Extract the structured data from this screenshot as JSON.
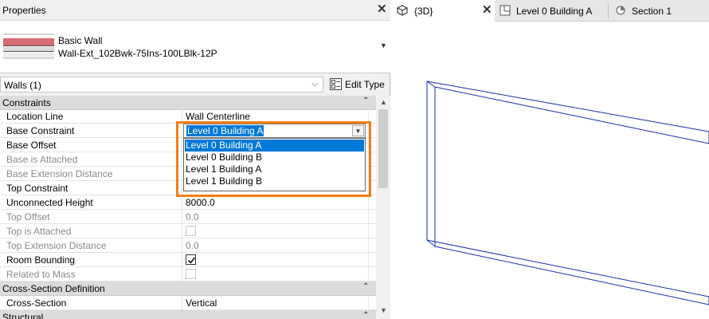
{
  "properties": {
    "title": "Properties",
    "type_family": "Basic Wall",
    "type_name": "Wall-Ext_102Bwk-75Ins-100LBlk-12P",
    "instance_filter": "Walls (1)",
    "edit_type_label": "Edit Type"
  },
  "groups": {
    "constraints": "Constraints",
    "cross_section": "Cross-Section Definition",
    "next_partial": "Structural"
  },
  "params": {
    "location_line": {
      "name": "Location Line",
      "value": "Wall Centerline"
    },
    "base_constraint": {
      "name": "Base Constraint",
      "value": "Level 0 Building A"
    },
    "base_offset": {
      "name": "Base Offset",
      "value": ""
    },
    "base_is_attached": {
      "name": "Base is Attached",
      "value": ""
    },
    "base_extension": {
      "name": "Base Extension Distance",
      "value": ""
    },
    "top_constraint": {
      "name": "Top Constraint",
      "value": ""
    },
    "unconnected_height": {
      "name": "Unconnected Height",
      "value": "8000.0"
    },
    "top_offset": {
      "name": "Top Offset",
      "value": "0.0"
    },
    "top_is_attached": {
      "name": "Top is Attached",
      "checked": false
    },
    "top_extension": {
      "name": "Top Extension Distance",
      "value": "0.0"
    },
    "room_bounding": {
      "name": "Room Bounding",
      "checked": true
    },
    "related_to_mass": {
      "name": "Related to Mass",
      "checked": false
    },
    "cross_section": {
      "name": "Cross-Section",
      "value": "Vertical"
    }
  },
  "dropdown": {
    "selected": "Level 0 Building A",
    "options": [
      "Level 0 Building A",
      "Level 0 Building B",
      "Level 1 Building A",
      "Level 1 Building B"
    ]
  },
  "tabs": [
    {
      "label": "{3D}",
      "active": true
    },
    {
      "label": "Level 0 Building A",
      "active": false
    },
    {
      "label": "Section 1",
      "active": false
    }
  ],
  "colors": {
    "highlight": "#f47f12",
    "selection": "#0078d7",
    "model_lines": "#1a2fa8"
  }
}
